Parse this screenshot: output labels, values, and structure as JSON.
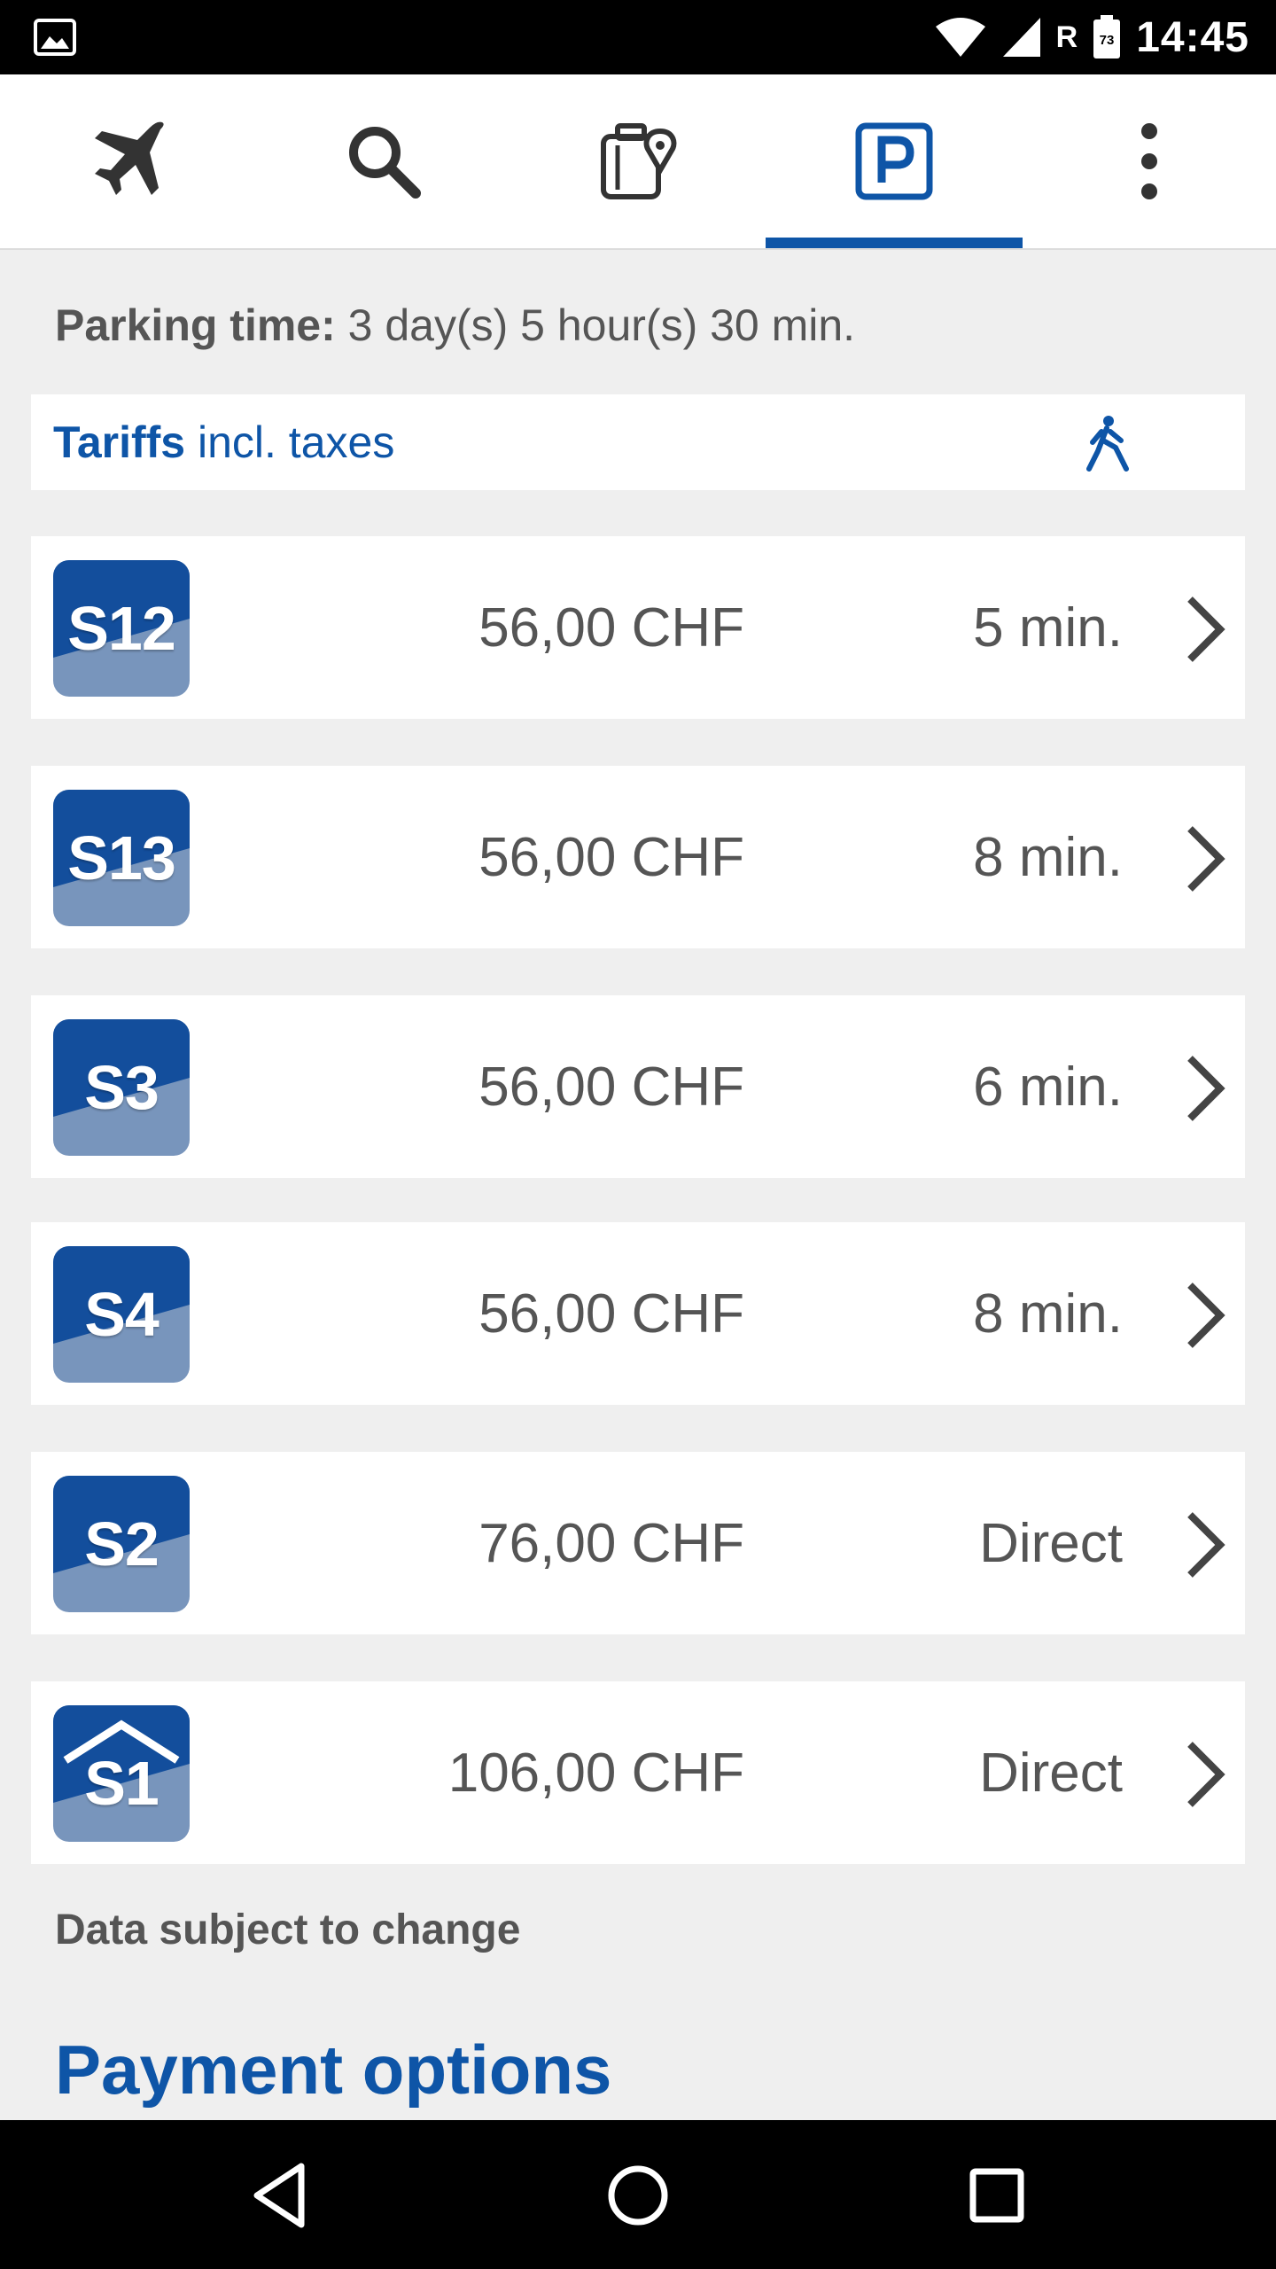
{
  "status_bar": {
    "time": "14:45",
    "carrier_flag": "R",
    "battery_level": "73"
  },
  "toolbar": {
    "tabs": [
      {
        "icon": "airplane-icon",
        "active": false
      },
      {
        "icon": "search-icon",
        "active": false
      },
      {
        "icon": "luggage-location-icon",
        "active": false
      },
      {
        "icon": "parking-icon",
        "active": true
      },
      {
        "icon": "more-vert-icon",
        "active": false
      }
    ],
    "accent_color": "#0e55a7"
  },
  "parking": {
    "label": "Parking time:",
    "value": " 3 day(s) 5 hour(s) 30 min."
  },
  "tariffs": {
    "title": "Tariffs",
    "subtitle": " incl. taxes",
    "walk_icon": "walking-person-icon"
  },
  "rows": [
    {
      "code": "S12",
      "price": "56,00 CHF",
      "walk": "5 min."
    },
    {
      "code": "S13",
      "price": "56,00 CHF",
      "walk": "8 min."
    },
    {
      "code": "S3",
      "price": "56,00 CHF",
      "walk": "6 min."
    },
    {
      "code": "S4",
      "price": "56,00 CHF",
      "walk": "8 min."
    },
    {
      "code": "S2",
      "price": "76,00 CHF",
      "walk": "Direct"
    },
    {
      "code": "S1",
      "price": "106,00 CHF",
      "walk": "Direct"
    }
  ],
  "note": "Data subject to change",
  "payment_title": "Payment options"
}
